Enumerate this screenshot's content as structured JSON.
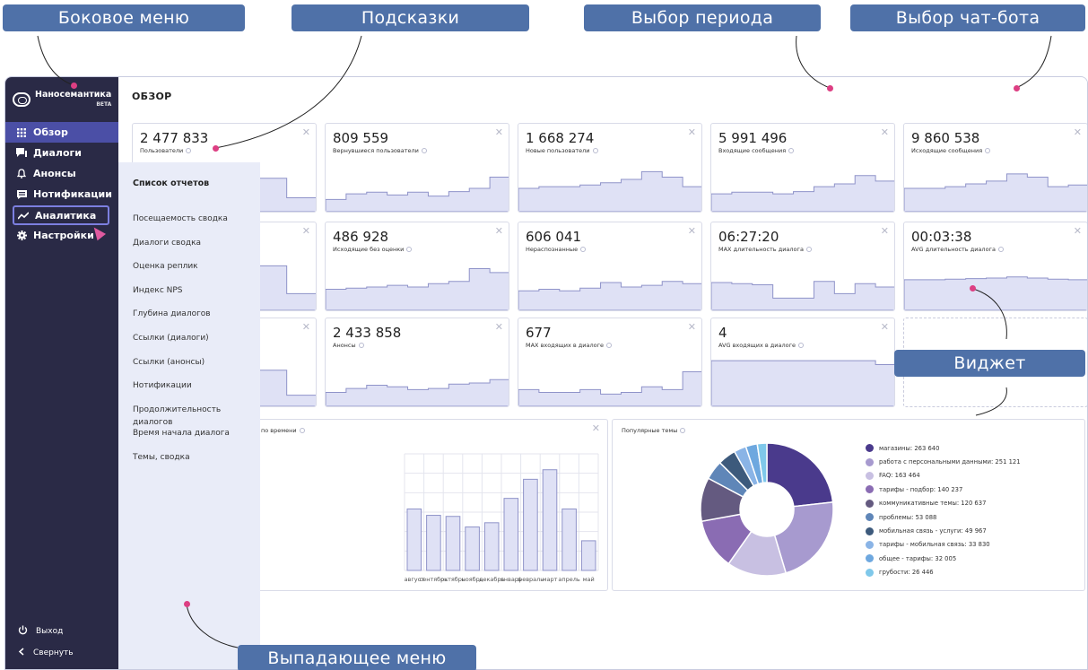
{
  "annotations": {
    "sidebar_menu": "Боковое меню",
    "hints": "Подсказки",
    "period_select": "Выбор периода",
    "chatbot_select": "Выбор чат-бота",
    "widget": "Виджет",
    "dropdown_menu": "Выпадающее меню"
  },
  "brand": {
    "name": "Наносемантика",
    "badge": "BETA"
  },
  "sidebar": {
    "items": [
      {
        "label": "Обзор",
        "icon": "grid-icon"
      },
      {
        "label": "Диалоги",
        "icon": "chat-icon"
      },
      {
        "label": "Анонсы",
        "icon": "bell-icon"
      },
      {
        "label": "Нотификации",
        "icon": "message-icon"
      },
      {
        "label": "Аналитика",
        "icon": "trend-icon"
      },
      {
        "label": "Настройки",
        "icon": "gear-icon"
      }
    ],
    "logout": "Выход",
    "collapse": "Свернуть"
  },
  "page": {
    "title": "ОБЗОР"
  },
  "dropdown": {
    "title": "Список отчетов",
    "items": [
      "Посещаемость сводка",
      "Диалоги сводка",
      "Оценка реплик",
      "Индекс NPS",
      "Глубина диалогов",
      "Ссылки (диалоги)",
      "Ссылки (анонсы)",
      "Нотификации",
      "Продолжительность диалогов",
      "Время начала диалога",
      "Темы, сводка"
    ]
  },
  "cards": [
    {
      "value": "2 477 833",
      "label": "Пользователи",
      "spark": [
        0.35,
        0.35,
        0.35,
        0.45,
        0.6,
        0.25
      ]
    },
    {
      "value": "809 559",
      "label": "Вернувшиеся пользователи",
      "spark": [
        0.22,
        0.32,
        0.35,
        0.3,
        0.35,
        0.28,
        0.36,
        0.42,
        0.62
      ]
    },
    {
      "value": "1 668 274",
      "label": "Новые пользователи",
      "spark": [
        0.42,
        0.45,
        0.45,
        0.48,
        0.52,
        0.58,
        0.72,
        0.62,
        0.45
      ]
    },
    {
      "value": "5 991 496",
      "label": "Входящие сообщения",
      "spark": [
        0.32,
        0.35,
        0.35,
        0.32,
        0.36,
        0.45,
        0.5,
        0.65,
        0.55
      ]
    },
    {
      "value": "9 860 538",
      "label": "Исходящие сообщения",
      "spark": [
        0.42,
        0.42,
        0.45,
        0.5,
        0.55,
        0.68,
        0.62,
        0.45,
        0.48
      ]
    },
    {
      "value": "",
      "label": "",
      "spark": [
        0.35,
        0.35,
        0.3,
        0.5,
        0.8,
        0.3
      ]
    },
    {
      "value": "486 928",
      "label": "Исходящие без оценки",
      "spark": [
        0.38,
        0.4,
        0.42,
        0.45,
        0.42,
        0.48,
        0.52,
        0.75,
        0.68
      ]
    },
    {
      "value": "606 041",
      "label": "Нераспознанные",
      "spark": [
        0.35,
        0.38,
        0.35,
        0.4,
        0.5,
        0.42,
        0.45,
        0.52,
        0.48
      ]
    },
    {
      "value": "06:27:20",
      "label": "MAX длительность диалога",
      "spark": [
        0.5,
        0.48,
        0.46,
        0.22,
        0.22,
        0.52,
        0.3,
        0.48,
        0.42
      ]
    },
    {
      "value": "00:03:38",
      "label": "AVG длительность диалога",
      "spark": [
        0.55,
        0.55,
        0.56,
        0.57,
        0.58,
        0.6,
        0.58,
        0.56,
        0.55
      ]
    },
    {
      "value": "",
      "label": "",
      "spark": [
        0.3,
        0.3,
        0.35,
        0.5,
        0.65,
        0.2
      ]
    },
    {
      "value": "2 433 858",
      "label": "Анонсы",
      "spark": [
        0.25,
        0.32,
        0.38,
        0.35,
        0.3,
        0.32,
        0.4,
        0.42,
        0.48
      ]
    },
    {
      "value": "677",
      "label": "MAX входящих в диалоге",
      "spark": [
        0.3,
        0.25,
        0.25,
        0.3,
        0.22,
        0.25,
        0.35,
        0.3,
        0.62
      ]
    },
    {
      "value": "4",
      "label": "AVG входящих в диалоге",
      "spark": [
        0.82,
        0.82,
        0.82,
        0.82,
        0.82,
        0.82,
        0.82,
        0.82,
        0.75
      ]
    }
  ],
  "time_panel": {
    "title": "по времени"
  },
  "topics_panel": {
    "title": "Популярные темы"
  },
  "chart_data": [
    {
      "type": "bar",
      "categories": [
        "август",
        "сентябрь",
        "октябрь",
        "ноябрь",
        "декабрь",
        "январь",
        "февраль",
        "март",
        "апрель",
        "май"
      ],
      "values": [
        58,
        52,
        51,
        41,
        45,
        68,
        86,
        95,
        58,
        28
      ],
      "ylim": [
        0,
        110
      ],
      "grid": true
    },
    {
      "type": "pie",
      "labels": [
        "магазины",
        "работа с персональными данными",
        "FAQ",
        "тарифы - подбор",
        "коммуникативные темы",
        "проблемы",
        "мобильная связь - услуги",
        "тарифы - мобильная связь",
        "общее - тарифы",
        "грубости"
      ],
      "values": [
        263640,
        251121,
        163464,
        140237,
        120637,
        53088,
        49967,
        33830,
        32005,
        26446
      ],
      "legend_text": [
        "магазины: 263 640",
        "работа с персональными данными: 251 121",
        "FAQ: 163 464",
        "тарифы - подбор: 140 237",
        "коммуникативные темы: 120 637",
        "проблемы: 53 088",
        "мобильная связь - услуги: 49 967",
        "тарифы - мобильная связь: 33 830",
        "общее - тарифы: 32 005",
        "грубости: 26 446"
      ],
      "colors": [
        "#4a3a8c",
        "#a79acf",
        "#c8c0e2",
        "#8a6cb3",
        "#645a80",
        "#5f86b8",
        "#3d5a7c",
        "#8ab4e6",
        "#6ea8df",
        "#7fc8ea"
      ],
      "legend": "right"
    }
  ]
}
